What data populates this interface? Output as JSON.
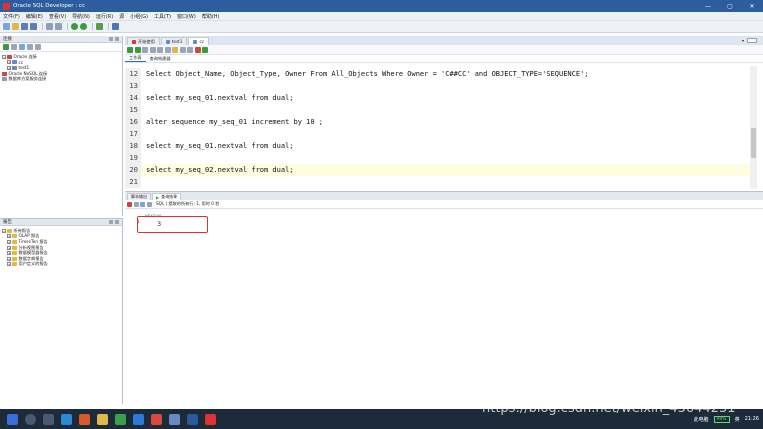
{
  "window": {
    "title": "Oracle SQL Developer : cc",
    "controls": [
      "—",
      "▢",
      "✕"
    ]
  },
  "menu": [
    "文件(F)",
    "编辑(E)",
    "查看(V)",
    "导航(N)",
    "运行(R)",
    "源",
    "小组(G)",
    "工具(T)",
    "窗口(W)",
    "帮助(H)"
  ],
  "connections_panel": {
    "title": "连接",
    "tree": [
      {
        "label": "Oracle 连接",
        "level": 0
      },
      {
        "label": "cc",
        "level": 1
      },
      {
        "label": "test1",
        "level": 1
      },
      {
        "label": "Oracle NoSQL 连接",
        "level": 0
      },
      {
        "label": "数据库方案服务连接",
        "level": 0
      }
    ]
  },
  "reports_panel": {
    "title": "报告",
    "tree": [
      {
        "label": "所有报告",
        "level": 0
      },
      {
        "label": "OLAP 报告",
        "level": 1
      },
      {
        "label": "TimesTen 报告",
        "level": 1
      },
      {
        "label": "分析视图报告",
        "level": 1
      },
      {
        "label": "数据模型器报告",
        "level": 1
      },
      {
        "label": "数据字典报告",
        "level": 1
      },
      {
        "label": "用户定义的报告",
        "level": 1
      }
    ]
  },
  "doc_tabs": [
    {
      "label": "开始使用",
      "active": false
    },
    {
      "label": "test1",
      "active": false
    },
    {
      "label": "cc",
      "active": true
    }
  ],
  "editor_subtabs": [
    "工作表",
    "查询构建器"
  ],
  "code_lines": [
    {
      "num": "12",
      "text": "Select Object_Name, Object_Type, Owner From All_Objects Where Owner = 'C##CC' and OBJECT_TYPE='SEQUENCE';",
      "current": false
    },
    {
      "num": "13",
      "text": "",
      "current": false
    },
    {
      "num": "14",
      "text": "select my_seq_01.nextval from dual;",
      "current": false
    },
    {
      "num": "15",
      "text": "",
      "current": false
    },
    {
      "num": "16",
      "text": "alter sequence my_seq_01 increment by 10 ;",
      "current": false
    },
    {
      "num": "17",
      "text": "",
      "current": false
    },
    {
      "num": "18",
      "text": "select my_seq_01.nextval from dual;",
      "current": false
    },
    {
      "num": "19",
      "text": "",
      "current": false
    },
    {
      "num": "20",
      "text": "select my_seq_02.nextval from dual;",
      "current": true
    },
    {
      "num": "21",
      "text": "",
      "current": false
    }
  ],
  "results": {
    "tabs": [
      {
        "label": "脚本输出",
        "active": false
      },
      {
        "label": "查询结果",
        "active": true
      }
    ],
    "toolbar_text": "SQL | 提取的所有行: 1, 用时 0 秒",
    "column_header": "NEXTVAL",
    "rows": [
      {
        "row": "1",
        "value": "3"
      }
    ]
  },
  "taskbar": {
    "battery": "99%",
    "tray_text": "此电脑",
    "ime": "英",
    "time": "21:26"
  },
  "watermark": "https://blog.csdn.net/weixin_43644231"
}
